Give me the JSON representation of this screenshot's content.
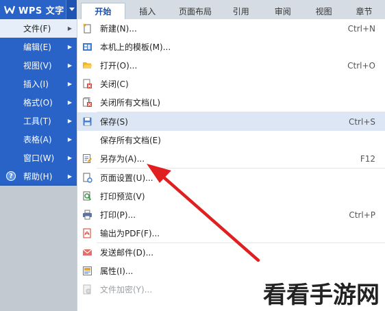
{
  "app": {
    "title": "WPS 文字"
  },
  "ribbon": {
    "tabs": [
      {
        "label": "开始",
        "active": true
      },
      {
        "label": "插入"
      },
      {
        "label": "页面布局"
      },
      {
        "label": "引用"
      },
      {
        "label": "审阅"
      },
      {
        "label": "视图"
      },
      {
        "label": "章节"
      }
    ]
  },
  "left_menu": {
    "items": [
      {
        "label": "文件(F)",
        "selected": true
      },
      {
        "label": "编辑(E)"
      },
      {
        "label": "视图(V)"
      },
      {
        "label": "插入(I)"
      },
      {
        "label": "格式(O)"
      },
      {
        "label": "工具(T)"
      },
      {
        "label": "表格(A)"
      },
      {
        "label": "窗口(W)"
      },
      {
        "label": "帮助(H)",
        "icon": "help-icon"
      }
    ]
  },
  "file_menu": {
    "items": [
      {
        "label": "新建(N)...",
        "shortcut": "Ctrl+N",
        "icon": "new-document-icon"
      },
      {
        "label": "本机上的模板(M)...",
        "shortcut": "",
        "icon": "template-icon"
      },
      {
        "label": "打开(O)...",
        "shortcut": "Ctrl+O",
        "icon": "open-folder-icon"
      },
      {
        "label": "关闭(C)",
        "shortcut": "",
        "icon": "close-document-icon"
      },
      {
        "label": "关闭所有文档(L)",
        "shortcut": "",
        "icon": "close-all-documents-icon"
      },
      {
        "label": "保存(S)",
        "shortcut": "Ctrl+S",
        "icon": "save-icon",
        "highlighted": true
      },
      {
        "label": "保存所有文档(E)",
        "shortcut": "",
        "icon": ""
      },
      {
        "label": "另存为(A)...",
        "shortcut": "F12",
        "icon": "save-as-icon"
      },
      {
        "label": "页面设置(U)...",
        "shortcut": "",
        "icon": "page-setup-icon"
      },
      {
        "label": "打印预览(V)",
        "shortcut": "",
        "icon": "print-preview-icon"
      },
      {
        "label": "打印(P)...",
        "shortcut": "Ctrl+P",
        "icon": "printer-icon"
      },
      {
        "label": "输出为PDF(F)...",
        "shortcut": "",
        "icon": "pdf-icon"
      },
      {
        "label": "发送邮件(D)...",
        "shortcut": "",
        "icon": "mail-icon"
      },
      {
        "label": "属性(I)...",
        "shortcut": "",
        "icon": "properties-icon"
      },
      {
        "label": "文件加密(Y)...",
        "shortcut": "",
        "icon": "encrypt-icon",
        "disabled": true
      }
    ]
  },
  "watermark": {
    "text": "看看手游网"
  },
  "colors": {
    "menu_blue": "#2a63c7",
    "highlight": "#dce6f4",
    "arrow_red": "#e02020"
  }
}
